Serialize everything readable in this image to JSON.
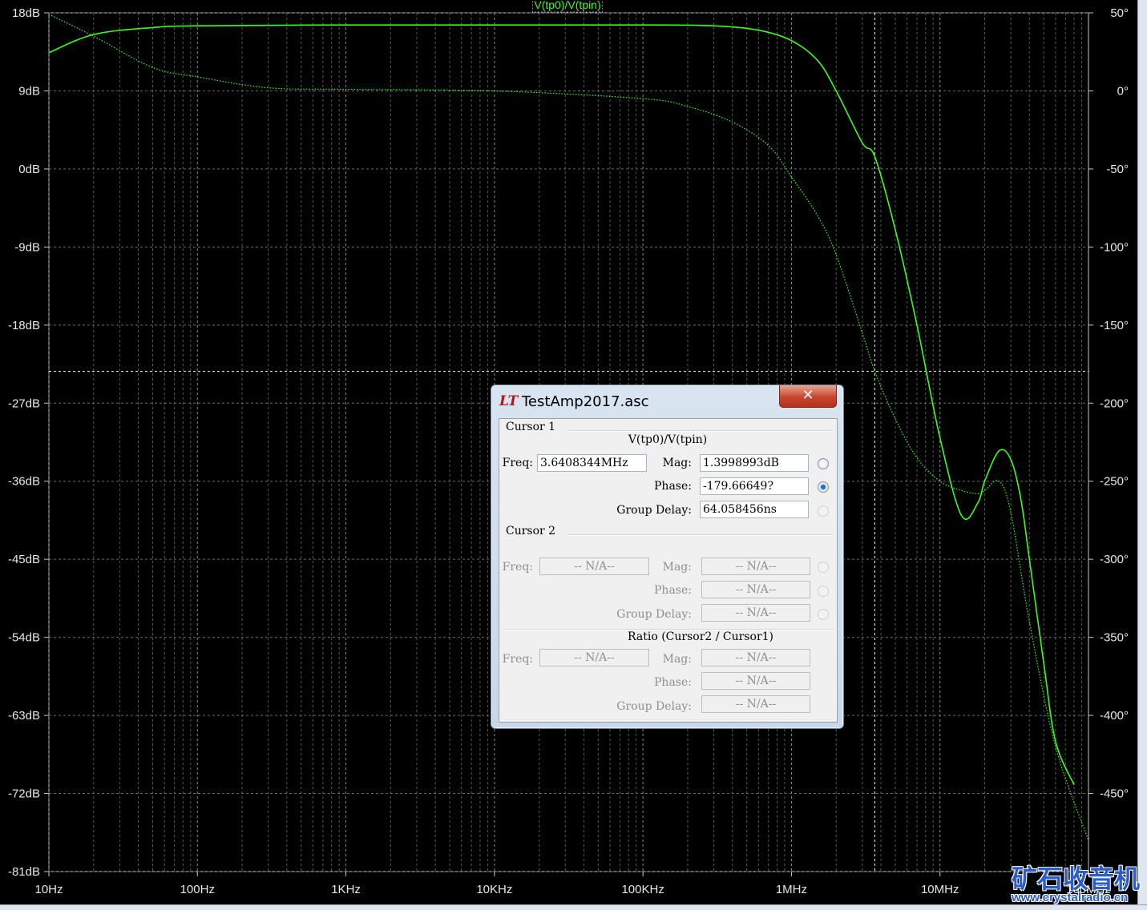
{
  "chart_data": {
    "type": "line",
    "title": "V(tp0)/V(tpin)",
    "x_scale": "log",
    "x_range_hz": [
      10,
      100000000
    ],
    "x_tick_values": [
      10,
      100,
      1000,
      10000,
      100000,
      1000000,
      10000000,
      100000000
    ],
    "x_tick_labels": [
      "10Hz",
      "100Hz",
      "1KHz",
      "10KHz",
      "100KHz",
      "1MHz",
      "10MHz",
      "100MHz"
    ],
    "y_left_range_db": [
      -81,
      18
    ],
    "y_left_tick_values": [
      18,
      9,
      0,
      -9,
      -18,
      -27,
      -36,
      -45,
      -54,
      -63,
      -72,
      -81
    ],
    "y_left_tick_labels": [
      "18dB",
      "9dB",
      "0dB",
      "-9dB",
      "-18dB",
      "-27dB",
      "-36dB",
      "-45dB",
      "-54dB",
      "-63dB",
      "-72dB",
      "-81dB"
    ],
    "y_right_range_deg": [
      -500,
      50
    ],
    "y_right_tick_values": [
      50,
      0,
      -50,
      -100,
      -150,
      -200,
      -250,
      -300,
      -350,
      -400,
      -450
    ],
    "y_right_tick_labels": [
      "50°",
      "0°",
      "-50°",
      "-100°",
      "-150°",
      "-200°",
      "-250°",
      "-300°",
      "-350°",
      "-400°",
      "-450°"
    ],
    "grid": true,
    "cursor": {
      "freq_hz": 3640834.4,
      "phase_deg": -179.66649
    },
    "series": [
      {
        "axis": "magnitude_db",
        "style": "solid",
        "color": "#39ff14",
        "x": [
          10,
          20,
          50,
          100,
          1000,
          10000,
          100000,
          300000,
          600000,
          1000000,
          1500000,
          2000000,
          3000000,
          3640834,
          5000000,
          7000000,
          10000000,
          14000000,
          18000000,
          20000000,
          25000000,
          30000000,
          35000000,
          40000000,
          50000000,
          60000000,
          80000000
        ],
        "y": [
          13.4,
          15.5,
          16.3,
          16.5,
          16.6,
          16.6,
          16.6,
          16.5,
          16.0,
          14.8,
          12.5,
          9.0,
          3.0,
          1.4,
          -7.0,
          -18.0,
          -31.0,
          -40.0,
          -38.5,
          -36.0,
          -32.5,
          -33.5,
          -38.0,
          -45.0,
          -57.0,
          -66.0,
          -71.0
        ]
      },
      {
        "axis": "phase_deg",
        "style": "dotted",
        "color": "#39ff14",
        "x": [
          10,
          20,
          50,
          100,
          300,
          1000,
          10000,
          100000,
          200000,
          400000,
          700000,
          1000000,
          1500000,
          2000000,
          3000000,
          3640834,
          5000000,
          7000000,
          10000000,
          14000000,
          18000000,
          20000000,
          25000000,
          30000000,
          40000000,
          60000000,
          100000000
        ],
        "y": [
          49,
          35,
          15,
          9,
          2,
          1,
          0,
          -5,
          -10,
          -20,
          -35,
          -55,
          -80,
          -105,
          -155,
          -179.7,
          -210,
          -235,
          -250,
          -256,
          -258,
          -256,
          -250,
          -270,
          -340,
          -420,
          -480
        ]
      }
    ]
  },
  "dialog": {
    "title": "TestAmp2017.asc",
    "close_glyph": "✕",
    "logo_text": "LT",
    "cursor1": {
      "heading": "Cursor 1",
      "trace": "V(tp0)/V(tpin)",
      "freq_label": "Freq:",
      "freq_value": "3.6408344MHz",
      "mag_label": "Mag:",
      "mag_value": "1.3998993dB",
      "phase_label": "Phase:",
      "phase_value": "-179.66649?",
      "gd_label": "Group Delay:",
      "gd_value": "64.058456ns"
    },
    "cursor2": {
      "heading": "Cursor 2",
      "freq_label": "Freq:",
      "freq_value": "-- N/A--",
      "mag_label": "Mag:",
      "mag_value": "-- N/A--",
      "phase_label": "Phase:",
      "phase_value": "-- N/A--",
      "gd_label": "Group Delay:",
      "gd_value": "-- N/A--"
    },
    "ratio": {
      "heading": "Ratio (Cursor2 / Cursor1)",
      "freq_label": "Freq:",
      "freq_value": "-- N/A--",
      "mag_label": "Mag:",
      "mag_value": "-- N/A--",
      "phase_label": "Phase:",
      "phase_value": "-- N/A--",
      "gd_label": "Group Delay:",
      "gd_value": "-- N/A--"
    }
  },
  "watermark": {
    "text": "矿石收音机",
    "url": "www.crystalradio.cn"
  }
}
